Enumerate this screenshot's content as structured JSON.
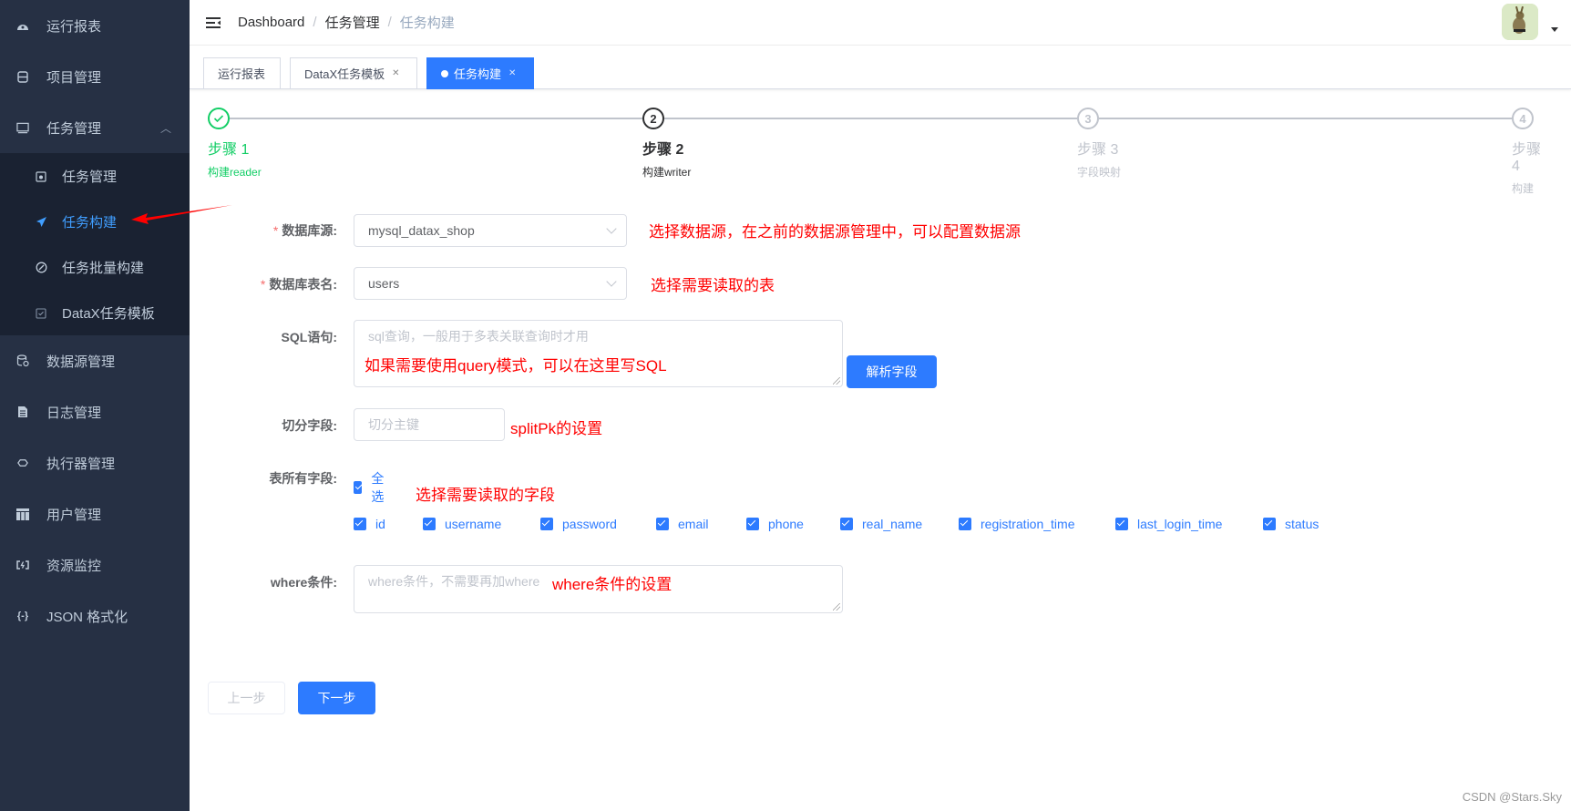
{
  "sidebar": {
    "items": [
      {
        "label": "运行报表",
        "icon": "dashboard-icon"
      },
      {
        "label": "项目管理",
        "icon": "project-icon"
      },
      {
        "label": "任务管理",
        "icon": "monitor-icon",
        "expanded": true
      },
      {
        "label": "数据源管理",
        "icon": "database-icon"
      },
      {
        "label": "日志管理",
        "icon": "document-icon"
      },
      {
        "label": "执行器管理",
        "icon": "executor-icon"
      },
      {
        "label": "用户管理",
        "icon": "table-icon"
      },
      {
        "label": "资源监控",
        "icon": "battery-icon"
      },
      {
        "label": "JSON 格式化",
        "icon": "braces-icon"
      }
    ],
    "submenu": [
      {
        "label": "任务管理",
        "icon": "calendar-icon"
      },
      {
        "label": "任务构建",
        "icon": "send-icon",
        "active": true
      },
      {
        "label": "任务批量构建",
        "icon": "gauge-icon"
      },
      {
        "label": "DataX任务模板",
        "icon": "clipboard-icon"
      }
    ]
  },
  "navbar": {
    "breadcrumb": [
      "Dashboard",
      "任务管理",
      "任务构建"
    ]
  },
  "tags": [
    {
      "label": "运行报表",
      "closable": false,
      "active": false
    },
    {
      "label": "DataX任务模板",
      "closable": true,
      "active": false
    },
    {
      "label": "任务构建",
      "closable": true,
      "active": true
    }
  ],
  "steps": [
    {
      "title": "步骤 1",
      "desc": "构建reader",
      "status": "finish",
      "num": "1"
    },
    {
      "title": "步骤 2",
      "desc": "构建writer",
      "status": "process",
      "num": "2"
    },
    {
      "title": "步骤 3",
      "desc": "字段映射",
      "status": "wait",
      "num": "3"
    },
    {
      "title": "步骤 4",
      "desc": "构建",
      "status": "wait",
      "num": "4"
    }
  ],
  "form": {
    "datasource": {
      "label": "数据库源:",
      "value": "mysql_datax_shop",
      "required": true
    },
    "table": {
      "label": "数据库表名:",
      "value": "users",
      "required": true
    },
    "sql": {
      "label": "SQL语句:",
      "placeholder": "sql查询，一般用于多表关联查询时才用"
    },
    "parse_button": "解析字段",
    "split": {
      "label": "切分字段:",
      "placeholder": "切分主键"
    },
    "fields": {
      "label": "表所有字段:",
      "select_all": "全选",
      "items": [
        "id",
        "username",
        "password",
        "email",
        "phone",
        "real_name",
        "registration_time",
        "last_login_time",
        "status"
      ]
    },
    "where": {
      "label": "where条件:",
      "placeholder": "where条件，不需要再加where"
    }
  },
  "buttons": {
    "prev": "上一步",
    "next": "下一步"
  },
  "annotations": {
    "datasource": "选择数据源，在之前的数据源管理中，可以配置数据源",
    "table": "选择需要读取的表",
    "sql": "如果需要使用query模式，可以在这里写SQL",
    "split": "splitPk的设置",
    "fields": "选择需要读取的字段",
    "where": "where条件的设置"
  },
  "watermark": "CSDN @Stars.Sky",
  "colors": {
    "primary": "#2d7bff",
    "success": "#13ce66",
    "sidebar": "#263044",
    "annotation": "#ff0000"
  }
}
